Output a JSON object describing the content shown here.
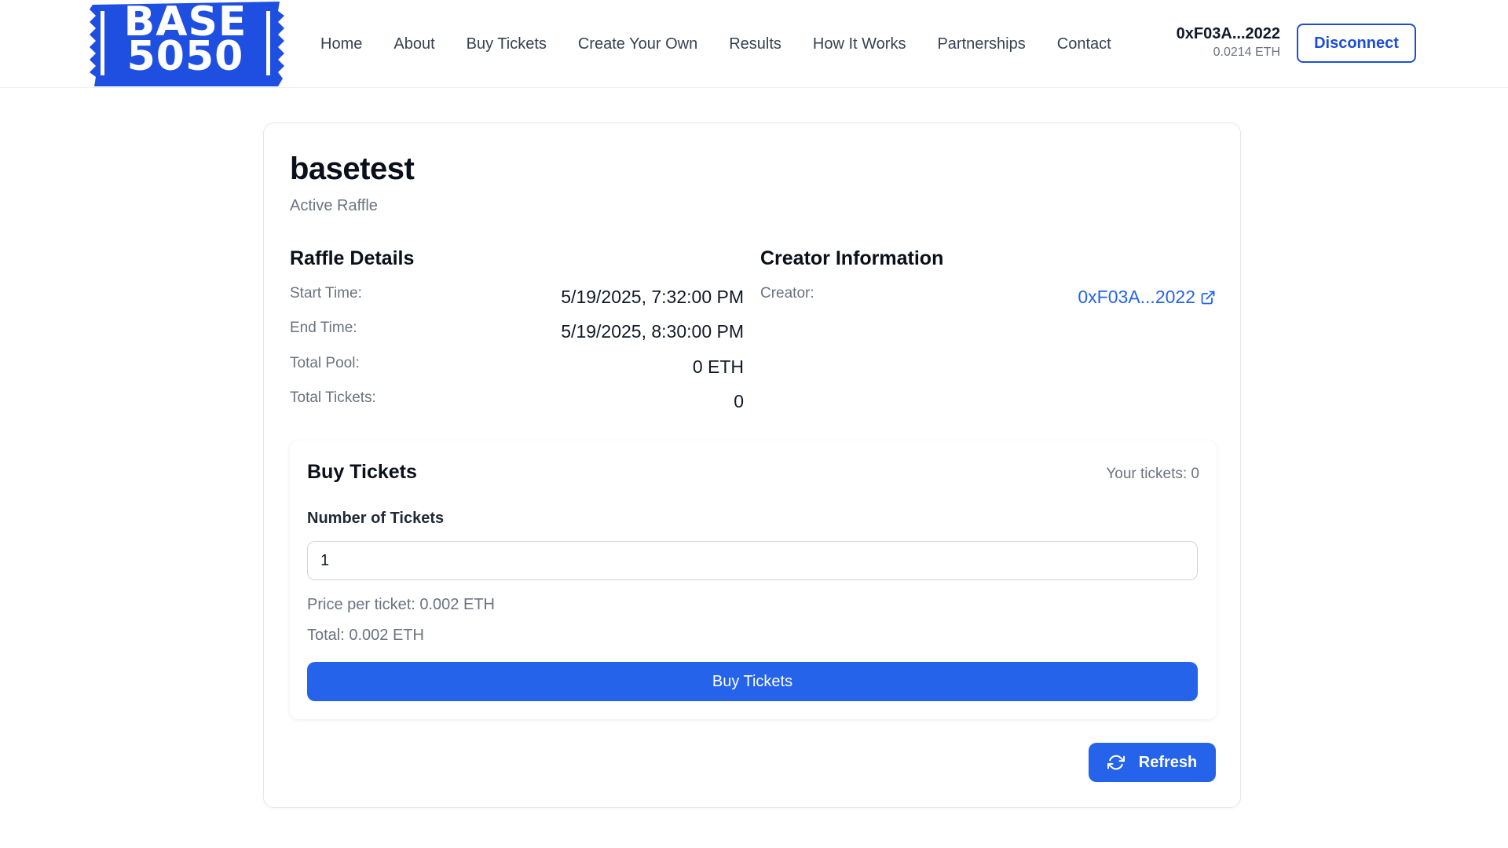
{
  "logo": {
    "line1": "BASE",
    "line2": "5050",
    "color": "#1f4fe0"
  },
  "nav": {
    "items": [
      "Home",
      "About",
      "Buy Tickets",
      "Create Your Own",
      "Results",
      "How It Works",
      "Partnerships",
      "Contact"
    ]
  },
  "wallet": {
    "address": "0xF03A...2022",
    "balance": "0.0214 ETH"
  },
  "disconnect_label": "Disconnect",
  "raffle": {
    "title": "basetest",
    "status": "Active Raffle",
    "details_title": "Raffle Details",
    "details": [
      {
        "label": "Start Time:",
        "value": "5/19/2025, 7:32:00 PM"
      },
      {
        "label": "End Time:",
        "value": "5/19/2025, 8:30:00 PM"
      },
      {
        "label": "Total Pool:",
        "value": "0 ETH"
      },
      {
        "label": "Total Tickets:",
        "value": "0"
      }
    ],
    "creator_title": "Creator Information",
    "creator_label": "Creator:",
    "creator_address": "0xF03A...2022"
  },
  "buy": {
    "title": "Buy Tickets",
    "your_tickets": "Your tickets: 0",
    "field_label": "Number of Tickets",
    "input_value": "1",
    "price": "Price per ticket: 0.002 ETH",
    "total": "Total: 0.002 ETH",
    "button_label": "Buy Tickets"
  },
  "refresh_label": "Refresh",
  "colors": {
    "accent": "#2563eb",
    "link": "#2563eb",
    "muted": "#6b7280"
  }
}
